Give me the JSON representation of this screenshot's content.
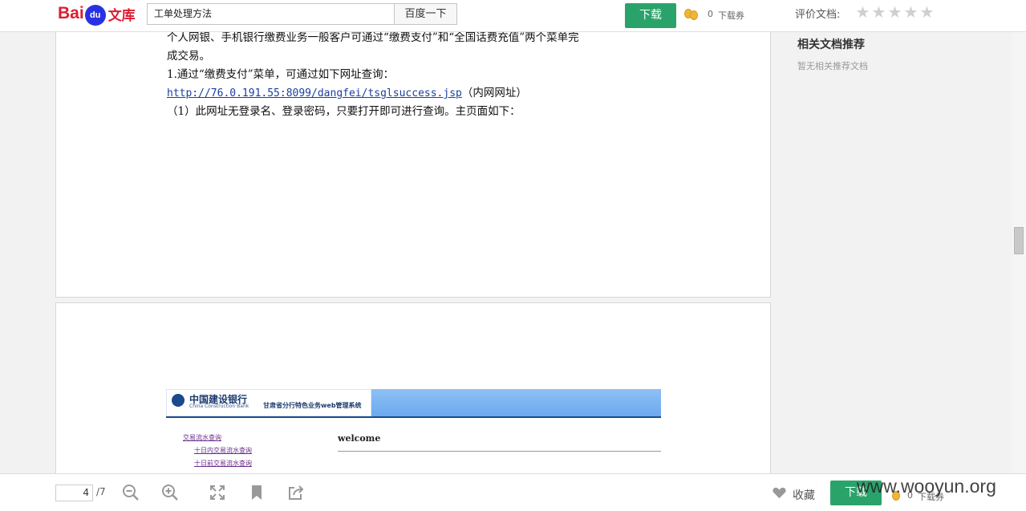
{
  "header": {
    "logo_text": "Bai",
    "logo_paw": "du",
    "logo_suffix": "文库",
    "search_value": "工单处理方法",
    "search_button": "百度一下",
    "download_button": "下载",
    "coin_count": "0",
    "coin_label": "下载券",
    "rating_label": "评价文档:",
    "stars": [
      "★",
      "★",
      "★",
      "★",
      "★"
    ]
  },
  "document": {
    "page1_lines": [
      "个人网银、手机银行缴费业务一般客户可通过“缴费支付”和“全国话费充值”两个菜单完",
      "成交易。",
      "1.通过“缴费支付”菜单，可通过如下网址查询：",
      "（1）此网址无登录名、登录密码，只要打开即可进行查询。主页面如下："
    ],
    "link_url": "http://76.0.191.55:8099/dangfei/tsglsuccess.jsp",
    "link_suffix": "（内网网址）",
    "bank_name_cn": "中国建设银行",
    "bank_name_en": "China Construction Bank",
    "system_name": "甘肃省分行特色业务web管理系统",
    "menu_items": [
      "交易流水查询",
      "十日内交易流水查询",
      "十日前交易流水查询"
    ],
    "welcome": "welcome"
  },
  "sidebar": {
    "title": "相关文档推荐",
    "empty_text": "暂无相关推荐文档"
  },
  "toolbar": {
    "current_page": "4",
    "total_pages": "/7",
    "favorite_label": "收藏",
    "download_button": "下载",
    "coin_count": "0",
    "coin_label": "下载券"
  },
  "watermark": "www.wooyun.org",
  "colors": {
    "accent_green": "#2aa36b",
    "baidu_red": "#de1c31",
    "baidu_blue": "#2932e1",
    "link_blue": "#1a3fa0"
  }
}
